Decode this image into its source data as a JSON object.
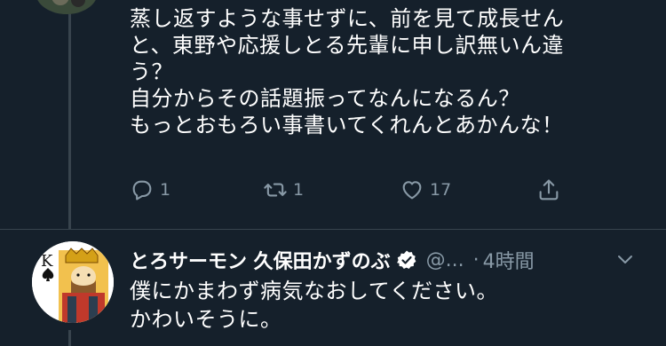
{
  "tweet1": {
    "lines": [
      "蒸し返すような事せずに、前を見て成長せん",
      "と、東野や応援しとる先輩に申し訳無いん違",
      "う？",
      "自分からその話題振ってなんになるん？",
      "もっとおもろい事書いてくれんとあかんな！"
    ],
    "reply_count": "1",
    "retweet_count": "1",
    "like_count": "17"
  },
  "tweet2": {
    "name": "とろサーモン 久保田かずのぶ",
    "handle": "@...",
    "dot": "·",
    "time": "4時間",
    "lines": [
      "僕にかまわず病気なおしてください。",
      "かわいそうに。"
    ]
  },
  "colors": {
    "background": "#15202b",
    "secondary_text": "#8899a6",
    "divider": "#38444d"
  },
  "icons": {
    "reply": "reply-icon",
    "retweet": "retweet-icon",
    "like": "heart-icon",
    "share": "share-icon",
    "verified": "verified-badge-icon",
    "menu": "chevron-down-icon"
  }
}
